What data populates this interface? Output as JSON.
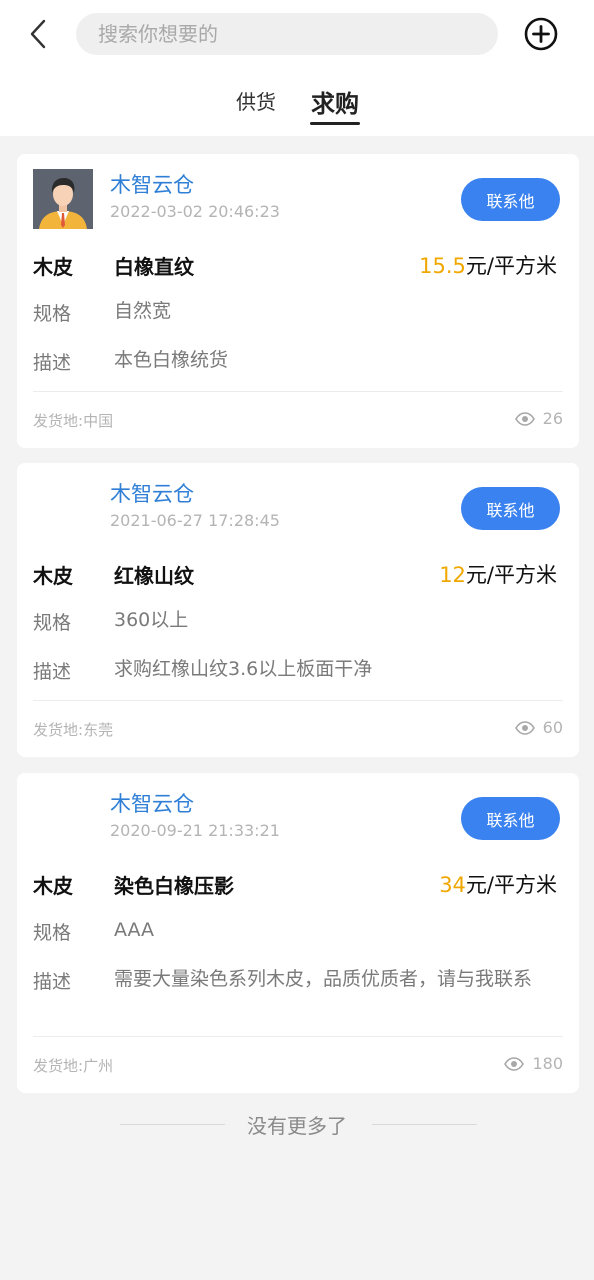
{
  "header": {
    "search_placeholder": "搜索你想要的",
    "tabs": [
      {
        "label": "供货",
        "active": false
      },
      {
        "label": "求购",
        "active": true
      }
    ]
  },
  "labels": {
    "spec": "规格",
    "desc": "描述",
    "ship_prefix": "发货地:",
    "contact": "联系他",
    "unit": "元/平方米"
  },
  "listings": [
    {
      "seller": "木智云仓",
      "time": "2022-03-02 20:46:23",
      "has_avatar": true,
      "category": "木皮",
      "product": "白橡直纹",
      "price": "15.5",
      "spec": "自然宽",
      "desc": "本色白橡统货",
      "ship_from": "中国",
      "views": "26"
    },
    {
      "seller": "木智云仓",
      "time": "2021-06-27 17:28:45",
      "has_avatar": false,
      "category": "木皮",
      "product": "红橡山纹",
      "price": "12",
      "spec": "360以上",
      "desc": "求购红橡山纹3.6以上板面干净",
      "ship_from": "东莞",
      "views": "60"
    },
    {
      "seller": "木智云仓",
      "time": "2020-09-21 21:33:21",
      "has_avatar": false,
      "category": "木皮",
      "product": "染色白橡压影",
      "price": "34",
      "spec": "AAA",
      "desc": "需要大量染色系列木皮，品质优质者，请与我联系",
      "ship_from": "广州",
      "views": "180"
    }
  ],
  "footer": {
    "end_text": "没有更多了"
  },
  "colors": {
    "accent_blue": "#3a82f0",
    "seller_blue": "#2f7fd6",
    "price_orange": "#f0a800"
  }
}
